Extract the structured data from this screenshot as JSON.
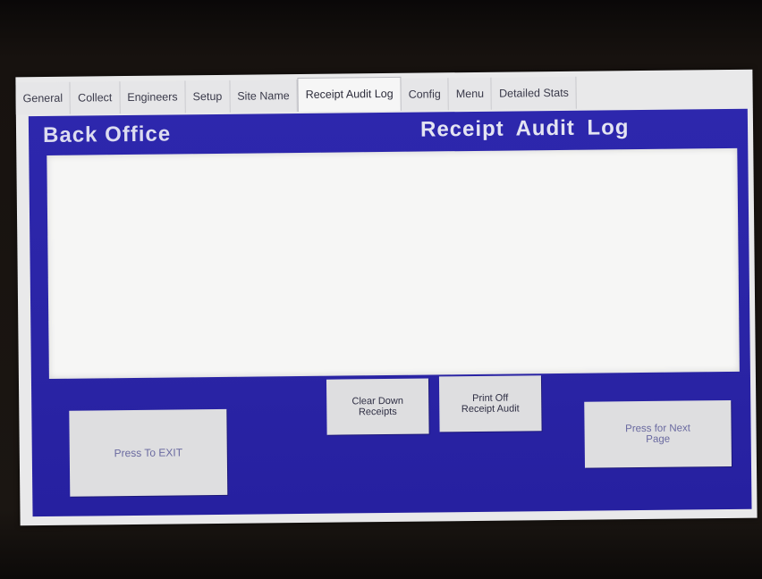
{
  "tabs": [
    {
      "label": "General"
    },
    {
      "label": "Collect"
    },
    {
      "label": "Engineers"
    },
    {
      "label": "Setup"
    },
    {
      "label": "Site Name"
    },
    {
      "label": "Receipt Audit Log",
      "active": true
    },
    {
      "label": "Config"
    },
    {
      "label": "Menu"
    },
    {
      "label": "Detailed Stats"
    }
  ],
  "header": {
    "app_title": "Back Office",
    "page_title": "Receipt Audit  Log"
  },
  "buttons": {
    "exit_label": "Press To EXIT",
    "clear_label": "Clear Down\nReceipts",
    "print_label": "Print Off\nReceipt Audit",
    "next_label": "Press for Next\nPage"
  },
  "colors": {
    "panel": "#2b25a6",
    "button": "#dedee0",
    "log_area": "#f6f6f5"
  }
}
